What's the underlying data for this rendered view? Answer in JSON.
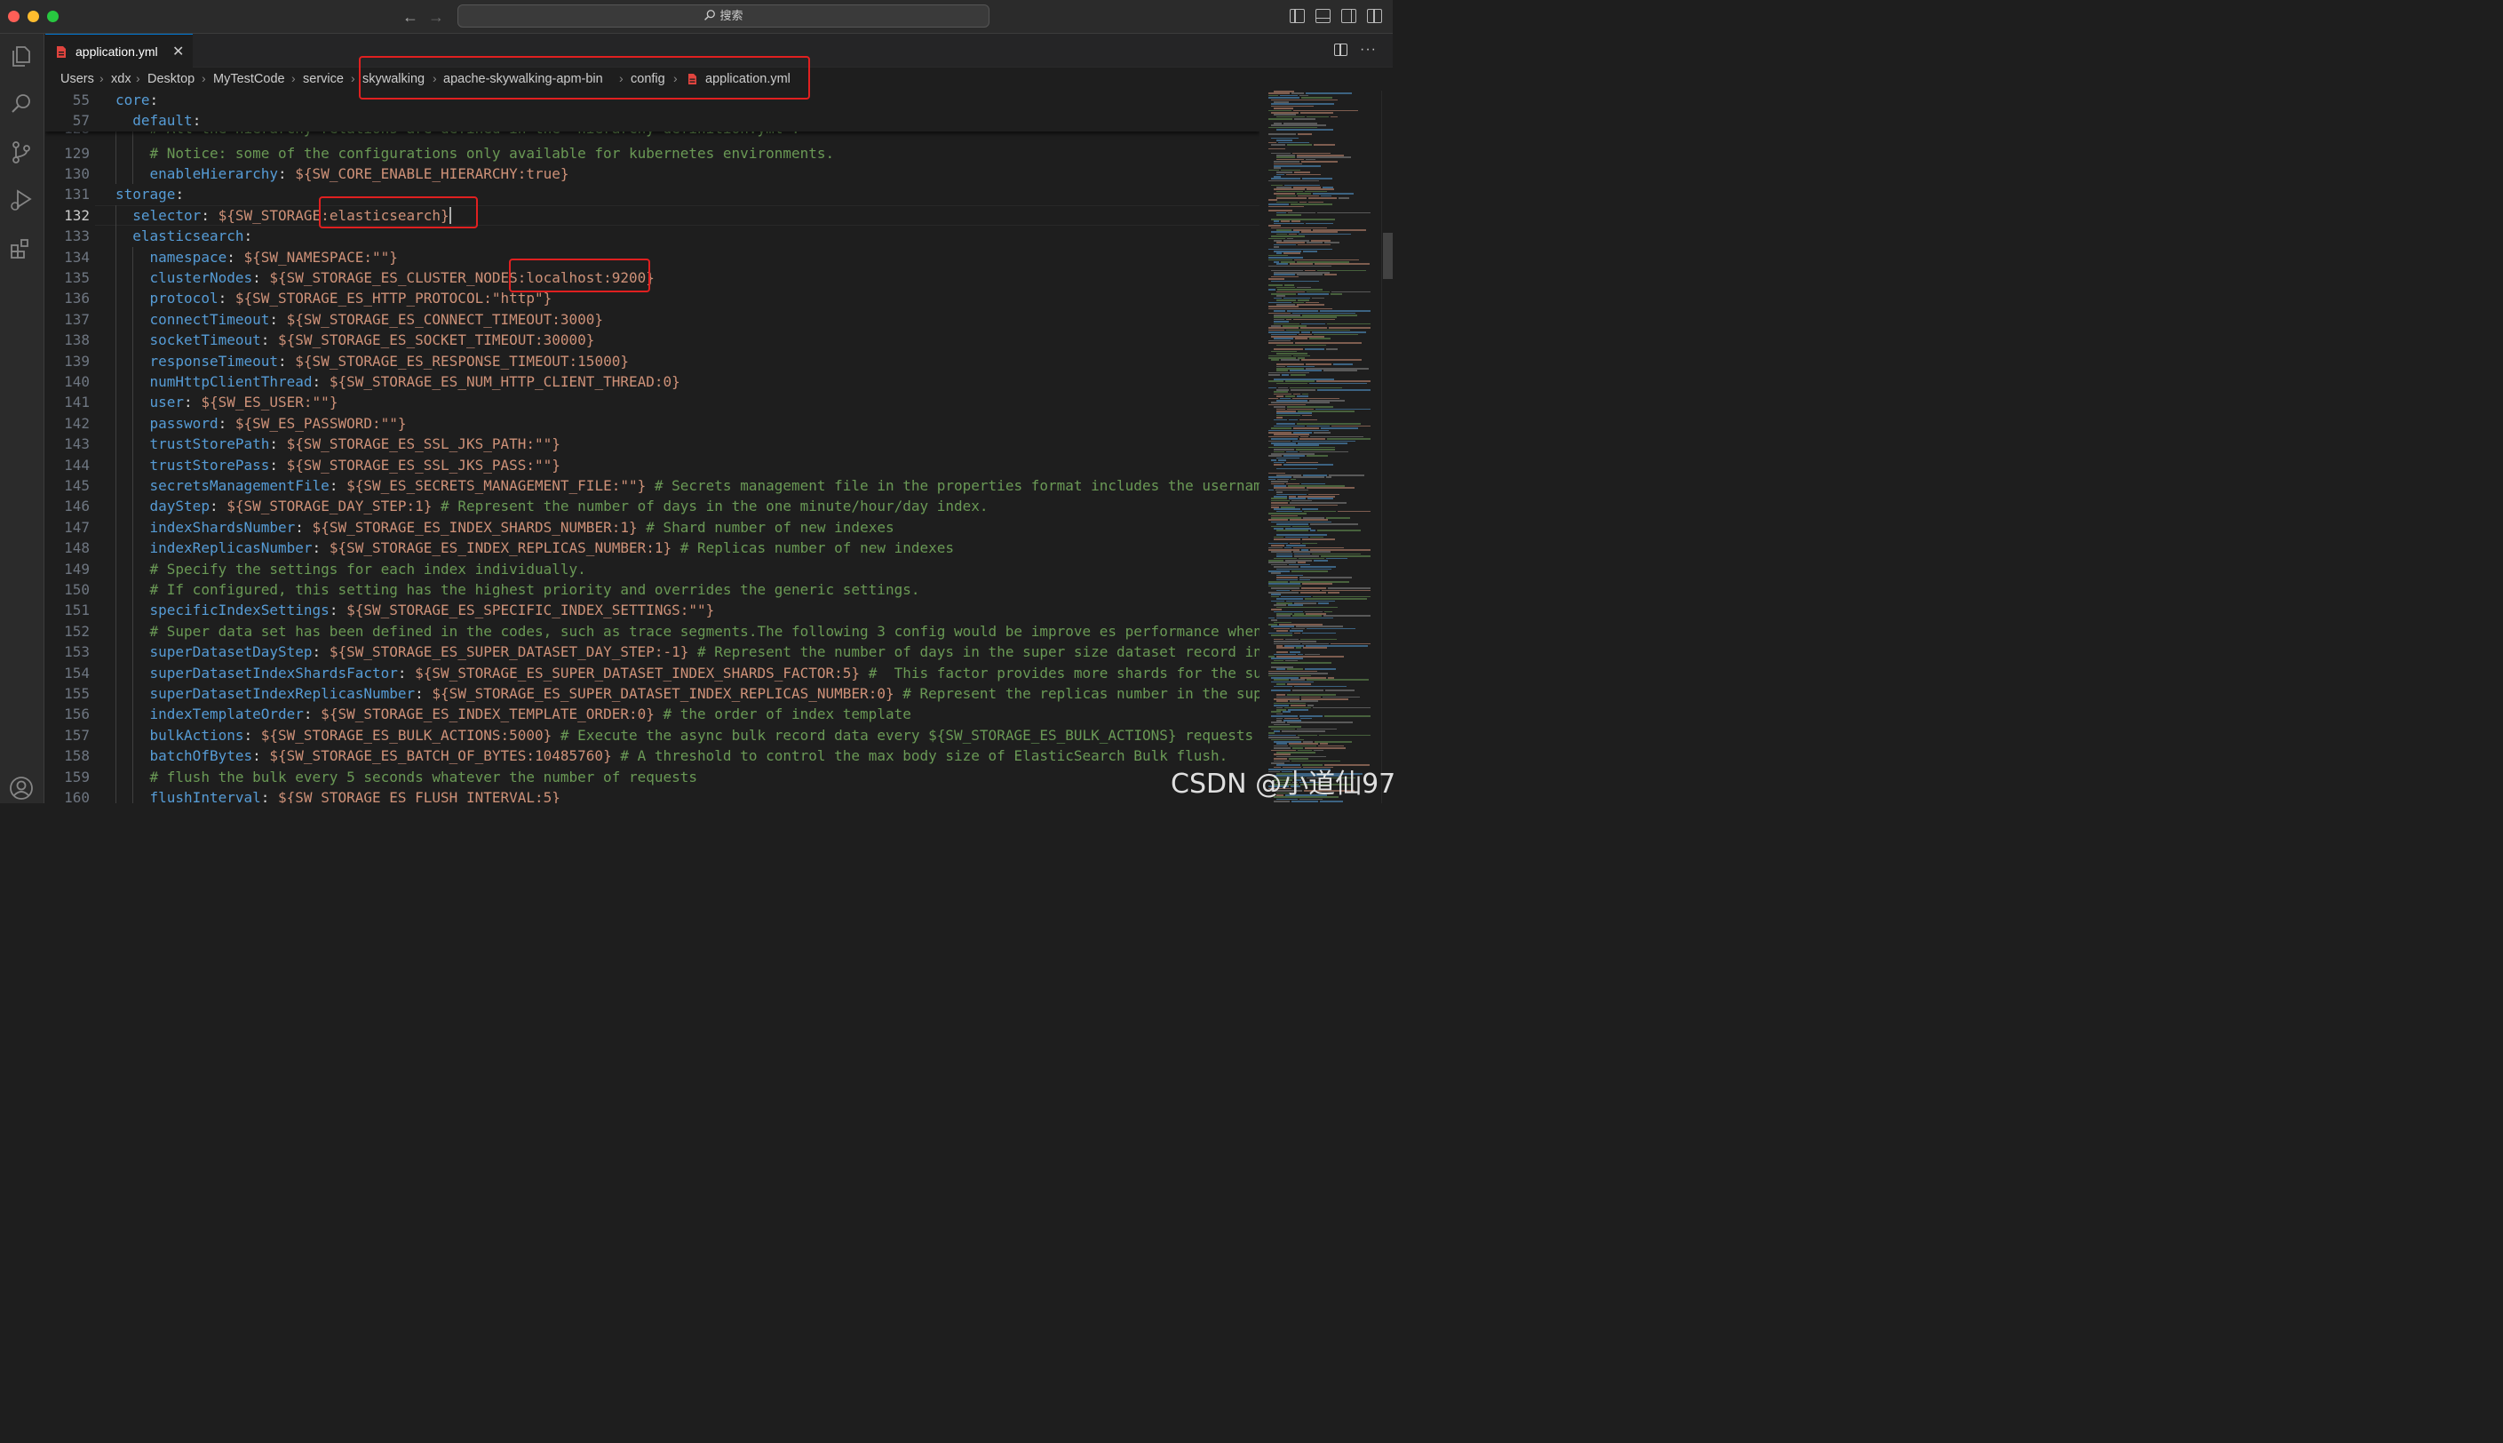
{
  "titlebar": {
    "search_label": "搜索"
  },
  "tab": {
    "label": "application.yml",
    "close": "✕"
  },
  "breadcrumb": {
    "items": [
      "Users",
      "xdx",
      "Desktop",
      "MyTestCode",
      "service",
      "skywalking",
      "apache-skywalking-apm-bin",
      "config",
      "application.yml"
    ],
    "separator": "›"
  },
  "sticky_lines": [
    {
      "num": "55",
      "indent": 0,
      "key": "core",
      "colon": ":",
      "value": "",
      "comment": ""
    },
    {
      "num": "57",
      "indent": 1,
      "key": "default",
      "colon": ":",
      "value": "",
      "comment": ""
    }
  ],
  "partial_line": {
    "num": "128",
    "text": "    # All the hierarchy relations are defined in the \"hierarchy-definition.yml\"."
  },
  "lines": [
    {
      "num": "129",
      "indent": 2,
      "key": "",
      "colon": "",
      "value": "",
      "comment": "# Notice: some of the configurations only available for kubernetes environments."
    },
    {
      "num": "130",
      "indent": 2,
      "key": "enableHierarchy",
      "colon": ":",
      "value": " ${SW_CORE_ENABLE_HIERARCHY:true}",
      "comment": ""
    },
    {
      "num": "131",
      "indent": 0,
      "key": "storage",
      "colon": ":",
      "value": "",
      "comment": ""
    },
    {
      "num": "132",
      "indent": 1,
      "key": "selector",
      "colon": ":",
      "value": " ${SW_STORAGE:elasticsearch}",
      "comment": "",
      "active": true
    },
    {
      "num": "133",
      "indent": 1,
      "key": "elasticsearch",
      "colon": ":",
      "value": "",
      "comment": ""
    },
    {
      "num": "134",
      "indent": 2,
      "key": "namespace",
      "colon": ":",
      "value": " ${SW_NAMESPACE:\"\"}",
      "comment": ""
    },
    {
      "num": "135",
      "indent": 2,
      "key": "clusterNodes",
      "colon": ":",
      "value": " ${SW_STORAGE_ES_CLUSTER_NODES:localhost:9200}",
      "comment": ""
    },
    {
      "num": "136",
      "indent": 2,
      "key": "protocol",
      "colon": ":",
      "value": " ${SW_STORAGE_ES_HTTP_PROTOCOL:\"http\"}",
      "comment": ""
    },
    {
      "num": "137",
      "indent": 2,
      "key": "connectTimeout",
      "colon": ":",
      "value": " ${SW_STORAGE_ES_CONNECT_TIMEOUT:3000}",
      "comment": ""
    },
    {
      "num": "138",
      "indent": 2,
      "key": "socketTimeout",
      "colon": ":",
      "value": " ${SW_STORAGE_ES_SOCKET_TIMEOUT:30000}",
      "comment": ""
    },
    {
      "num": "139",
      "indent": 2,
      "key": "responseTimeout",
      "colon": ":",
      "value": " ${SW_STORAGE_ES_RESPONSE_TIMEOUT:15000}",
      "comment": ""
    },
    {
      "num": "140",
      "indent": 2,
      "key": "numHttpClientThread",
      "colon": ":",
      "value": " ${SW_STORAGE_ES_NUM_HTTP_CLIENT_THREAD:0}",
      "comment": ""
    },
    {
      "num": "141",
      "indent": 2,
      "key": "user",
      "colon": ":",
      "value": " ${SW_ES_USER:\"\"}",
      "comment": ""
    },
    {
      "num": "142",
      "indent": 2,
      "key": "password",
      "colon": ":",
      "value": " ${SW_ES_PASSWORD:\"\"}",
      "comment": ""
    },
    {
      "num": "143",
      "indent": 2,
      "key": "trustStorePath",
      "colon": ":",
      "value": " ${SW_STORAGE_ES_SSL_JKS_PATH:\"\"}",
      "comment": ""
    },
    {
      "num": "144",
      "indent": 2,
      "key": "trustStorePass",
      "colon": ":",
      "value": " ${SW_STORAGE_ES_SSL_JKS_PASS:\"\"}",
      "comment": ""
    },
    {
      "num": "145",
      "indent": 2,
      "key": "secretsManagementFile",
      "colon": ":",
      "value": " ${SW_ES_SECRETS_MANAGEMENT_FILE:\"\"}",
      "comment": " # Secrets management file in the properties format includes the username, password"
    },
    {
      "num": "146",
      "indent": 2,
      "key": "dayStep",
      "colon": ":",
      "value": " ${SW_STORAGE_DAY_STEP:1}",
      "comment": " # Represent the number of days in the one minute/hour/day index."
    },
    {
      "num": "147",
      "indent": 2,
      "key": "indexShardsNumber",
      "colon": ":",
      "value": " ${SW_STORAGE_ES_INDEX_SHARDS_NUMBER:1}",
      "comment": " # Shard number of new indexes"
    },
    {
      "num": "148",
      "indent": 2,
      "key": "indexReplicasNumber",
      "colon": ":",
      "value": " ${SW_STORAGE_ES_INDEX_REPLICAS_NUMBER:1}",
      "comment": " # Replicas number of new indexes"
    },
    {
      "num": "149",
      "indent": 2,
      "key": "",
      "colon": "",
      "value": "",
      "comment": "# Specify the settings for each index individually."
    },
    {
      "num": "150",
      "indent": 2,
      "key": "",
      "colon": "",
      "value": "",
      "comment": "# If configured, this setting has the highest priority and overrides the generic settings."
    },
    {
      "num": "151",
      "indent": 2,
      "key": "specificIndexSettings",
      "colon": ":",
      "value": " ${SW_STORAGE_ES_SPECIFIC_INDEX_SETTINGS:\"\"}",
      "comment": ""
    },
    {
      "num": "152",
      "indent": 2,
      "key": "",
      "colon": "",
      "value": "",
      "comment": "# Super data set has been defined in the codes, such as trace segments.The following 3 config would be improve es performance when storage"
    },
    {
      "num": "153",
      "indent": 2,
      "key": "superDatasetDayStep",
      "colon": ":",
      "value": " ${SW_STORAGE_ES_SUPER_DATASET_DAY_STEP:-1}",
      "comment": " # Represent the number of days in the super size dataset record index"
    },
    {
      "num": "154",
      "indent": 2,
      "key": "superDatasetIndexShardsFactor",
      "colon": ":",
      "value": " ${SW_STORAGE_ES_SUPER_DATASET_INDEX_SHARDS_FACTOR:5}",
      "comment": " #  This factor provides more shards for the super size"
    },
    {
      "num": "155",
      "indent": 2,
      "key": "superDatasetIndexReplicasNumber",
      "colon": ":",
      "value": " ${SW_STORAGE_ES_SUPER_DATASET_INDEX_REPLICAS_NUMBER:0}",
      "comment": " # Represent the replicas number in the super size"
    },
    {
      "num": "156",
      "indent": 2,
      "key": "indexTemplateOrder",
      "colon": ":",
      "value": " ${SW_STORAGE_ES_INDEX_TEMPLATE_ORDER:0}",
      "comment": " # the order of index template"
    },
    {
      "num": "157",
      "indent": 2,
      "key": "bulkActions",
      "colon": ":",
      "value": " ${SW_STORAGE_ES_BULK_ACTIONS:5000}",
      "comment": " # Execute the async bulk record data every ${SW_STORAGE_ES_BULK_ACTIONS} requests"
    },
    {
      "num": "158",
      "indent": 2,
      "key": "batchOfBytes",
      "colon": ":",
      "value": " ${SW_STORAGE_ES_BATCH_OF_BYTES:10485760}",
      "comment": " # A threshold to control the max body size of ElasticSearch Bulk flush."
    },
    {
      "num": "159",
      "indent": 2,
      "key": "",
      "colon": "",
      "value": "",
      "comment": "# flush the bulk every 5 seconds whatever the number of requests"
    },
    {
      "num": "160",
      "indent": 2,
      "key": "flushInterval",
      "colon": ":",
      "value": " ${SW_STORAGE_ES_FLUSH_INTERVAL:5}",
      "comment": ""
    }
  ],
  "watermark": "CSDN @小道仙97",
  "colors": {
    "key": "#569cd6",
    "value": "#ce9178",
    "comment": "#6a9955",
    "highlight": "#e02020",
    "accent": "#0078d4"
  },
  "icons": [
    "explorer-icon",
    "search-icon",
    "source-control-icon",
    "run-debug-icon",
    "extensions-icon",
    "account-icon",
    "split-editor-icon",
    "more-actions-icon"
  ]
}
